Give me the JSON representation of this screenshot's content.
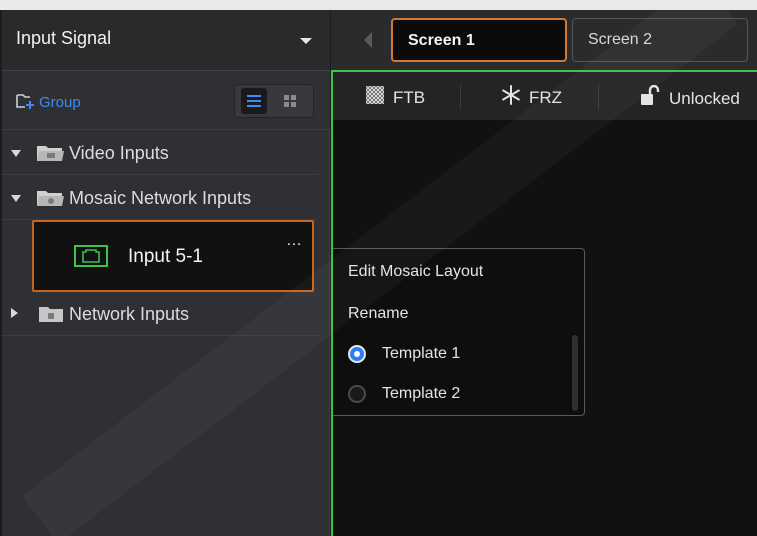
{
  "left_panel": {
    "header_title": "Input Signal",
    "group_button_label": "Group",
    "tree": [
      {
        "label": "Video Inputs",
        "expanded": true
      },
      {
        "label": "Mosaic Network Inputs",
        "expanded": true
      },
      {
        "label": "Network Inputs",
        "expanded": false
      }
    ],
    "selected_input": {
      "label": "Input 5-1",
      "more": "…"
    }
  },
  "screen_tabs": [
    "Screen 1",
    "Screen 2"
  ],
  "controls": {
    "ftb": "FTB",
    "frz": "FRZ",
    "lock": "Unlocked"
  },
  "context_menu": {
    "edit": "Edit Mosaic Layout",
    "rename": "Rename",
    "templates": [
      {
        "label": "Template 1",
        "selected": true
      },
      {
        "label": "Template 2",
        "selected": false
      }
    ]
  },
  "colors": {
    "accent_orange": "#c8641f",
    "accent_green": "#3cc24a",
    "accent_blue": "#3d8cf5"
  }
}
